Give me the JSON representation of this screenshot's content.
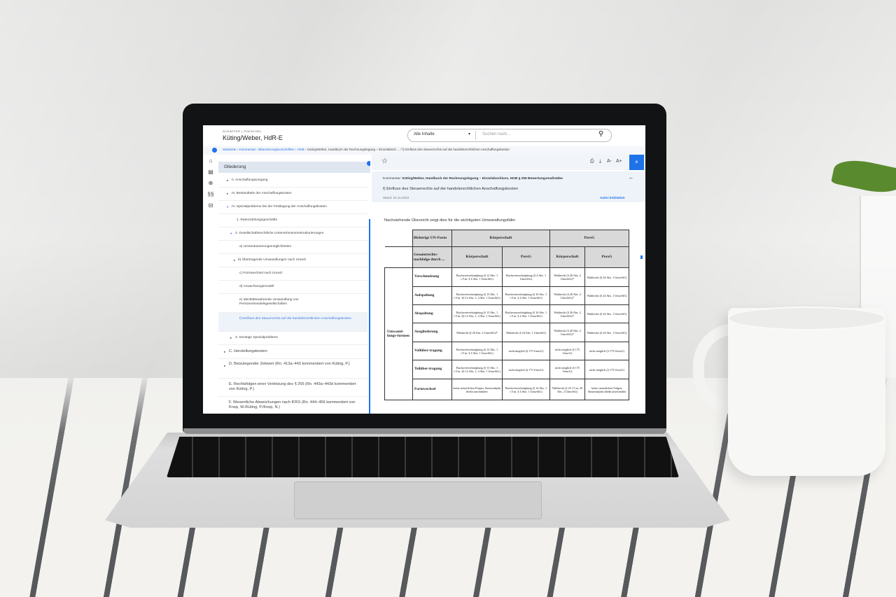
{
  "app": {
    "brand": "SCHÄFFER | POESCHEL",
    "title": "Küting/Weber, HdR-E"
  },
  "search": {
    "scope": "Alle Inhalte",
    "placeholder": "Suchen nach..."
  },
  "breadcrumb": {
    "items": [
      "Startseite",
      "Kommentar",
      "Bilanzierungsvorschriften",
      "HGB"
    ],
    "current": "Küting/Weber, Handbuch der Rechnungslegung – Einzelabsch ... / f) Einfluss des Steuerrechts auf die handelsrechtlichen Anschaffungskosten"
  },
  "toc": {
    "header": "Gliederung",
    "items": [
      {
        "label": "II. Anschaffungsvorgang",
        "expander": "▸"
      },
      {
        "label": "III. Bestandteile der Anschaffungskosten",
        "expander": "▸"
      },
      {
        "label": "IV. Spezialprobleme bei der Festlegung der Anschaffungskosten",
        "expander": "▾"
      },
      {
        "label": "1. Ratenzahlungsgeschäfte",
        "expander": ""
      },
      {
        "label": "2. Gesellschaftsrechtliche Unternehmensrestrukturierungen",
        "expander": "▾"
      },
      {
        "label": "a) Umstrukturierungsmöglichkeiten",
        "expander": ""
      },
      {
        "label": "b) Übertragende Umwandlungen nach UmwG",
        "expander": "▸"
      },
      {
        "label": "c) Formwechsel nach UmwG",
        "expander": ""
      },
      {
        "label": "d) Anwachsungsmodell",
        "expander": ""
      },
      {
        "label": "e) Identitätswahrende Umwandlung von Personenhandelsgesellschaften",
        "expander": ""
      },
      {
        "label": "f) Einfluss des Steuerrechts auf die handelsrechtlichen Anschaffungskosten",
        "expander": ""
      },
      {
        "label": "3. Sonstige Spezialprobleme",
        "expander": "▸"
      },
      {
        "label": "C. Herstellungskosten",
        "expander": "▸"
      },
      {
        "label": "D. Beizulegender Zeitwert (Rn. 413a–443 kommentiert von Küting, P.)",
        "expander": "▸"
      },
      {
        "label": "E. Rechtsfolgen einer Verletzung des § 255 (Rn. 443a–443d kommentiert von Küting, P.)",
        "expander": ""
      },
      {
        "label": "F. Wesentliche Abweichungen nach IFRS (Rn. 444–456 kommentiert von Knop, W./Küting, P./Knop, N.)",
        "expander": ""
      }
    ]
  },
  "doc": {
    "meta_prefix": "Kommentar:",
    "meta_source": "Küting/Weber, Handbuch der Rechnungslegung – Einzelabschluss, HGB § 255 Bewertungsmaßstäbe",
    "heading": "f) Einfluss des Steuerrechts auf die handelsrechtlichen Anschaffungskosten",
    "date": "Stand: 22.11.2023",
    "authors_link": "Autor:in/Zitation",
    "intro": "Nachstehende Übersicht zeigt dies für die wichtigsten Umwandlungsfälle:"
  },
  "table": {
    "h_bisherige": "Bisherige UN-Form",
    "h_koerperschaft": "Körperschaft",
    "h_persg": "PersG",
    "h_gesamt": "Gesamtrechts-nachfolge durch ...",
    "sub": [
      "Körperschaft",
      "PersG",
      "Körperschaft",
      "PersG"
    ],
    "group_label": "Umwand-lungs-formen",
    "rows": [
      {
        "label": "Verschmelzung",
        "cells": [
          "Buchwertverknüpfung (§ 12 Abs. 1 i.V.m. § 4 Abs. 1 UmwStG)",
          "Buchwertverknüpfung (§ 4 Abs. 1 UmwStG)",
          "Wahlrecht (§ 20 Abs. 2 UmwStG)*",
          "Wahlrecht (§ 24 Abs. 1 UmwStG)"
        ]
      },
      {
        "label": "Aufspaltung",
        "cells": [
          "Buchwertverknüpfung (§ 15 Abs. 1 i.V.m. §§ 12 Abs. 1, 4 Abs. 1 UmwStG)",
          "Buchwertverknüpfung (§ 16 Abs. 1 i.V.m. § 4 Abs. 1 UmwStG)",
          "Wahlrecht (§ 20 Abs. 2 UmwStG)*",
          "Wahlrecht (§ 24 Abs. 1 UmwStG)"
        ]
      },
      {
        "label": "Abspaltung",
        "cells": [
          "Buchwertverknüpfung (§ 15 Abs. 1 i.V.m. §§ 12 Abs. 1, 4 Abs. 1 UmwStG)",
          "Buchwertverknüpfung (§ 16 Abs. 1 i.V.m. § 4 Abs. 1 UmwStG)",
          "Wahlrecht (§ 20 Abs. 2 UmwStG)*",
          "Wahlrecht (§ 24 Abs. 1 UmwStG)"
        ]
      },
      {
        "label": "Ausgliederung",
        "cells": [
          "Wahlrecht (§ 20 Abs. 2 UmwStG)*",
          "Wahlrecht (§ 24 Abs. 1 UmwStG)",
          "Wahlrecht (§ 20 Abs. 2 UmwStG)*",
          "Wahlrecht (§ 24 Abs. 1 UmwStG)"
        ]
      },
      {
        "label": "Vollüber-tragung",
        "cells": [
          "Buchwertverknüpfung (§ 12 Abs. 1 i.V.m. § 4 Abs. 1 UmwStG)",
          "nicht möglich (§ 175 UmwG)",
          "nicht möglich (§ 175 UmwG)",
          "nicht möglich (§ 175 UmwG)"
        ]
      },
      {
        "label": "Teilüber-tragung",
        "cells": [
          "Buchwertverknüpfung (§ 15 Abs. 1 i.V.m. §§ 12 Abs. 1, 4 Abs. 1 UmwStG)",
          "nicht möglich (§ 175 UmwG)",
          "nicht möglich (§ 175 UmwG)",
          "nicht möglich (§ 175 UmwG)"
        ]
      },
      {
        "label": "Formwechsel",
        "cells": [
          "keine steuerlichen Folgen, Steuersubjekt bleibt unverändert",
          "Buchwertverknüpfung (§ 14 Abs. 1 i.V.m. § 4 Abs. 1 UmwStG)",
          "Wahlrecht (§ 25 i.V.m. 20 Abs. 2 UmwStG)",
          "keine steuerlichen Folgen, Steuersubjekt bleibt unverändert"
        ]
      }
    ]
  }
}
